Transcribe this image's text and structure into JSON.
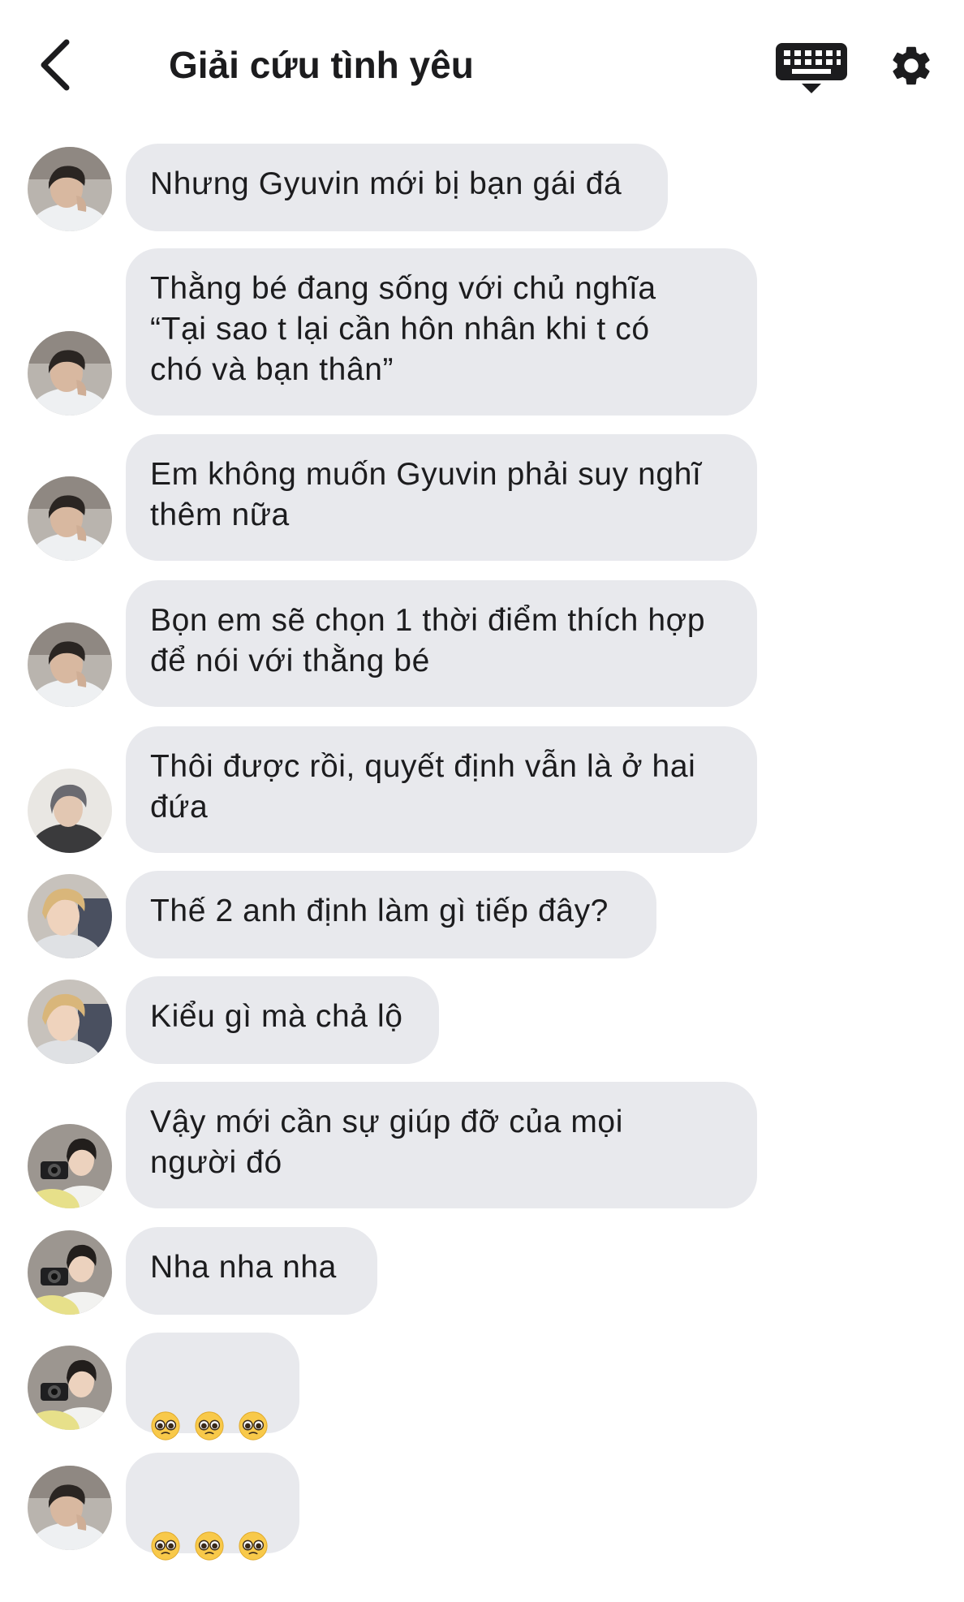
{
  "header": {
    "title": "Giải cứu tình yêu",
    "back_icon": "chevron-left-icon",
    "keyboard_icon": "keyboard-icon",
    "settings_icon": "gear-icon"
  },
  "colors": {
    "bubble": "#e8e9ed",
    "text": "#1c1c1e",
    "background": "#ffffff"
  },
  "messages": [
    {
      "sender": "A",
      "text": "Nhưng Gyuvin mới bị bạn gái đá"
    },
    {
      "sender": "A",
      "text": "Thằng bé đang sống với chủ nghĩa\n“Tại sao t lại cần hôn nhân khi t có\nchó và bạn thân”"
    },
    {
      "sender": "A",
      "text": "Em không muốn Gyuvin phải suy nghĩ\nthêm nữa"
    },
    {
      "sender": "A",
      "text": "Bọn em sẽ chọn 1 thời điểm thích hợp\nđể nói với thằng bé"
    },
    {
      "sender": "B",
      "text": "Thôi được rồi, quyết định vẫn là ở hai\nđứa"
    },
    {
      "sender": "C",
      "text": "Thế 2 anh định làm gì tiếp đây?"
    },
    {
      "sender": "C",
      "text": "Kiểu gì mà chả lộ"
    },
    {
      "sender": "D",
      "text": "Vậy mới cần sự giúp đỡ của mọi\nngười đó"
    },
    {
      "sender": "D",
      "text": "Nha nha nha"
    },
    {
      "sender": "D",
      "emoji": [
        "pleading-face-emoji",
        "pleading-face-emoji",
        "pleading-face-emoji"
      ]
    },
    {
      "sender": "A",
      "emoji": [
        "pleading-face-emoji",
        "pleading-face-emoji",
        "pleading-face-emoji"
      ]
    }
  ]
}
